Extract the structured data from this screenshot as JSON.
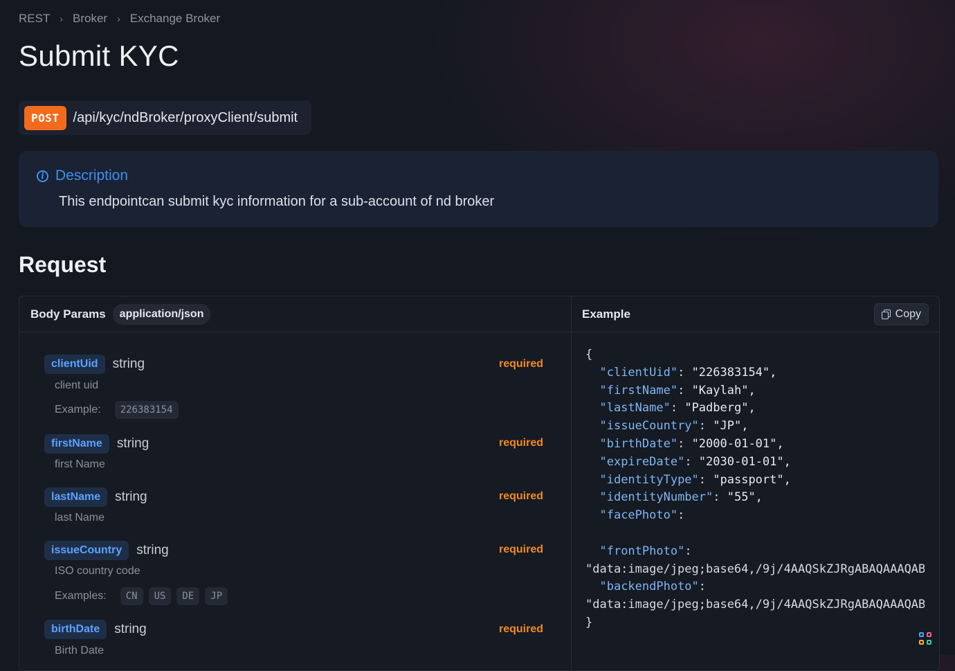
{
  "breadcrumb": [
    "REST",
    "Broker",
    "Exchange Broker"
  ],
  "page": {
    "title": "Submit KYC"
  },
  "endpoint": {
    "method": "POST",
    "path": "/api/kyc/ndBroker/proxyClient/submit"
  },
  "description": {
    "title": "Description",
    "text": "This endpointcan submit kyc information for a sub-account of nd broker"
  },
  "request": {
    "title": "Request",
    "body_label": "Body Params",
    "content_type": "application/json",
    "example_label": "Example",
    "copy_label": "Copy",
    "required_label": "required",
    "params": [
      {
        "name": "clientUid",
        "type": "string",
        "description": "client uid",
        "example_label": "Example:",
        "examples": [
          "226383154"
        ]
      },
      {
        "name": "firstName",
        "type": "string",
        "description": "first Name"
      },
      {
        "name": "lastName",
        "type": "string",
        "description": "last Name"
      },
      {
        "name": "issueCountry",
        "type": "string",
        "description": "ISO country code",
        "example_label": "Examples:",
        "examples": [
          "CN",
          "US",
          "DE",
          "JP"
        ]
      },
      {
        "name": "birthDate",
        "type": "string",
        "description": "Birth Date"
      }
    ]
  },
  "example_code": [
    {
      "t": "{"
    },
    {
      "k": "\"clientUid\"",
      "v": "\"226383154\","
    },
    {
      "k": "\"firstName\"",
      "v": "\"Kaylah\","
    },
    {
      "k": "\"lastName\"",
      "v": "\"Padberg\","
    },
    {
      "k": "\"issueCountry\"",
      "v": "\"JP\","
    },
    {
      "k": "\"birthDate\"",
      "v": "\"2000-01-01\","
    },
    {
      "k": "\"expireDate\"",
      "v": "\"2030-01-01\","
    },
    {
      "k": "\"identityType\"",
      "v": "\"passport\","
    },
    {
      "k": "\"identityNumber\"",
      "v": "\"55\","
    },
    {
      "k": "\"facePhoto\"",
      "v": ""
    },
    {
      "t": ""
    },
    {
      "k": "\"frontPhoto\"",
      "v": ""
    },
    {
      "t": "\"data:image/jpeg;base64,/9j/4AAQSkZJRgABAQAAAQAB/"
    },
    {
      "k": "\"backendPhoto\"",
      "v": ""
    },
    {
      "t": "\"data:image/jpeg;base64,/9j/4AAQSkZJRgABAQAAAQAB/"
    },
    {
      "t": "}"
    }
  ],
  "colors": {
    "accent": "#3f8ff1",
    "method": "#f26b1d",
    "required": "#f28a1c"
  }
}
